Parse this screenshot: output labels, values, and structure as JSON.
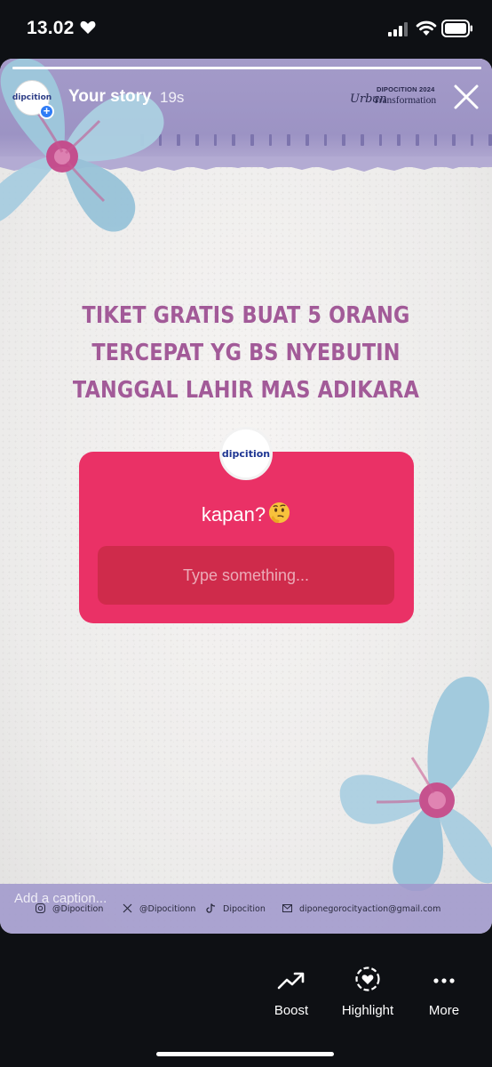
{
  "status_bar": {
    "time": "13.02"
  },
  "story": {
    "progress": 1.0,
    "username": "Your story",
    "elapsed": "19s",
    "avatar_text": "dipcition",
    "brand": {
      "line1": "DIPOCITION 2024",
      "line2": "Urban",
      "line3": "Transformation"
    },
    "headline": "TIKET GRATIS BUAT 5 ORANG\nTERCEPAT YG BS NYEBUTIN\nTANGGAL LAHIR  MAS ADIKARA",
    "question_sticker": {
      "avatar_text": "dipcition",
      "question": "kapan?",
      "emoji": "thinking-face",
      "placeholder": "Type something..."
    },
    "footer": {
      "caption_placeholder": "Add a caption...",
      "instagram": "@Dipocition",
      "x": "@Dipocitionn",
      "tiktok": "Dipocition",
      "email": "diponegorocityaction@gmail.com"
    },
    "colors": {
      "headline": "#a25a98",
      "sticker": "#ea3166",
      "band": "#a49bc9"
    }
  },
  "actions": [
    {
      "label": "Boost",
      "icon": "trending-up-icon"
    },
    {
      "label": "Highlight",
      "icon": "highlight-heart-icon"
    },
    {
      "label": "More",
      "icon": "more-dots-icon"
    }
  ]
}
